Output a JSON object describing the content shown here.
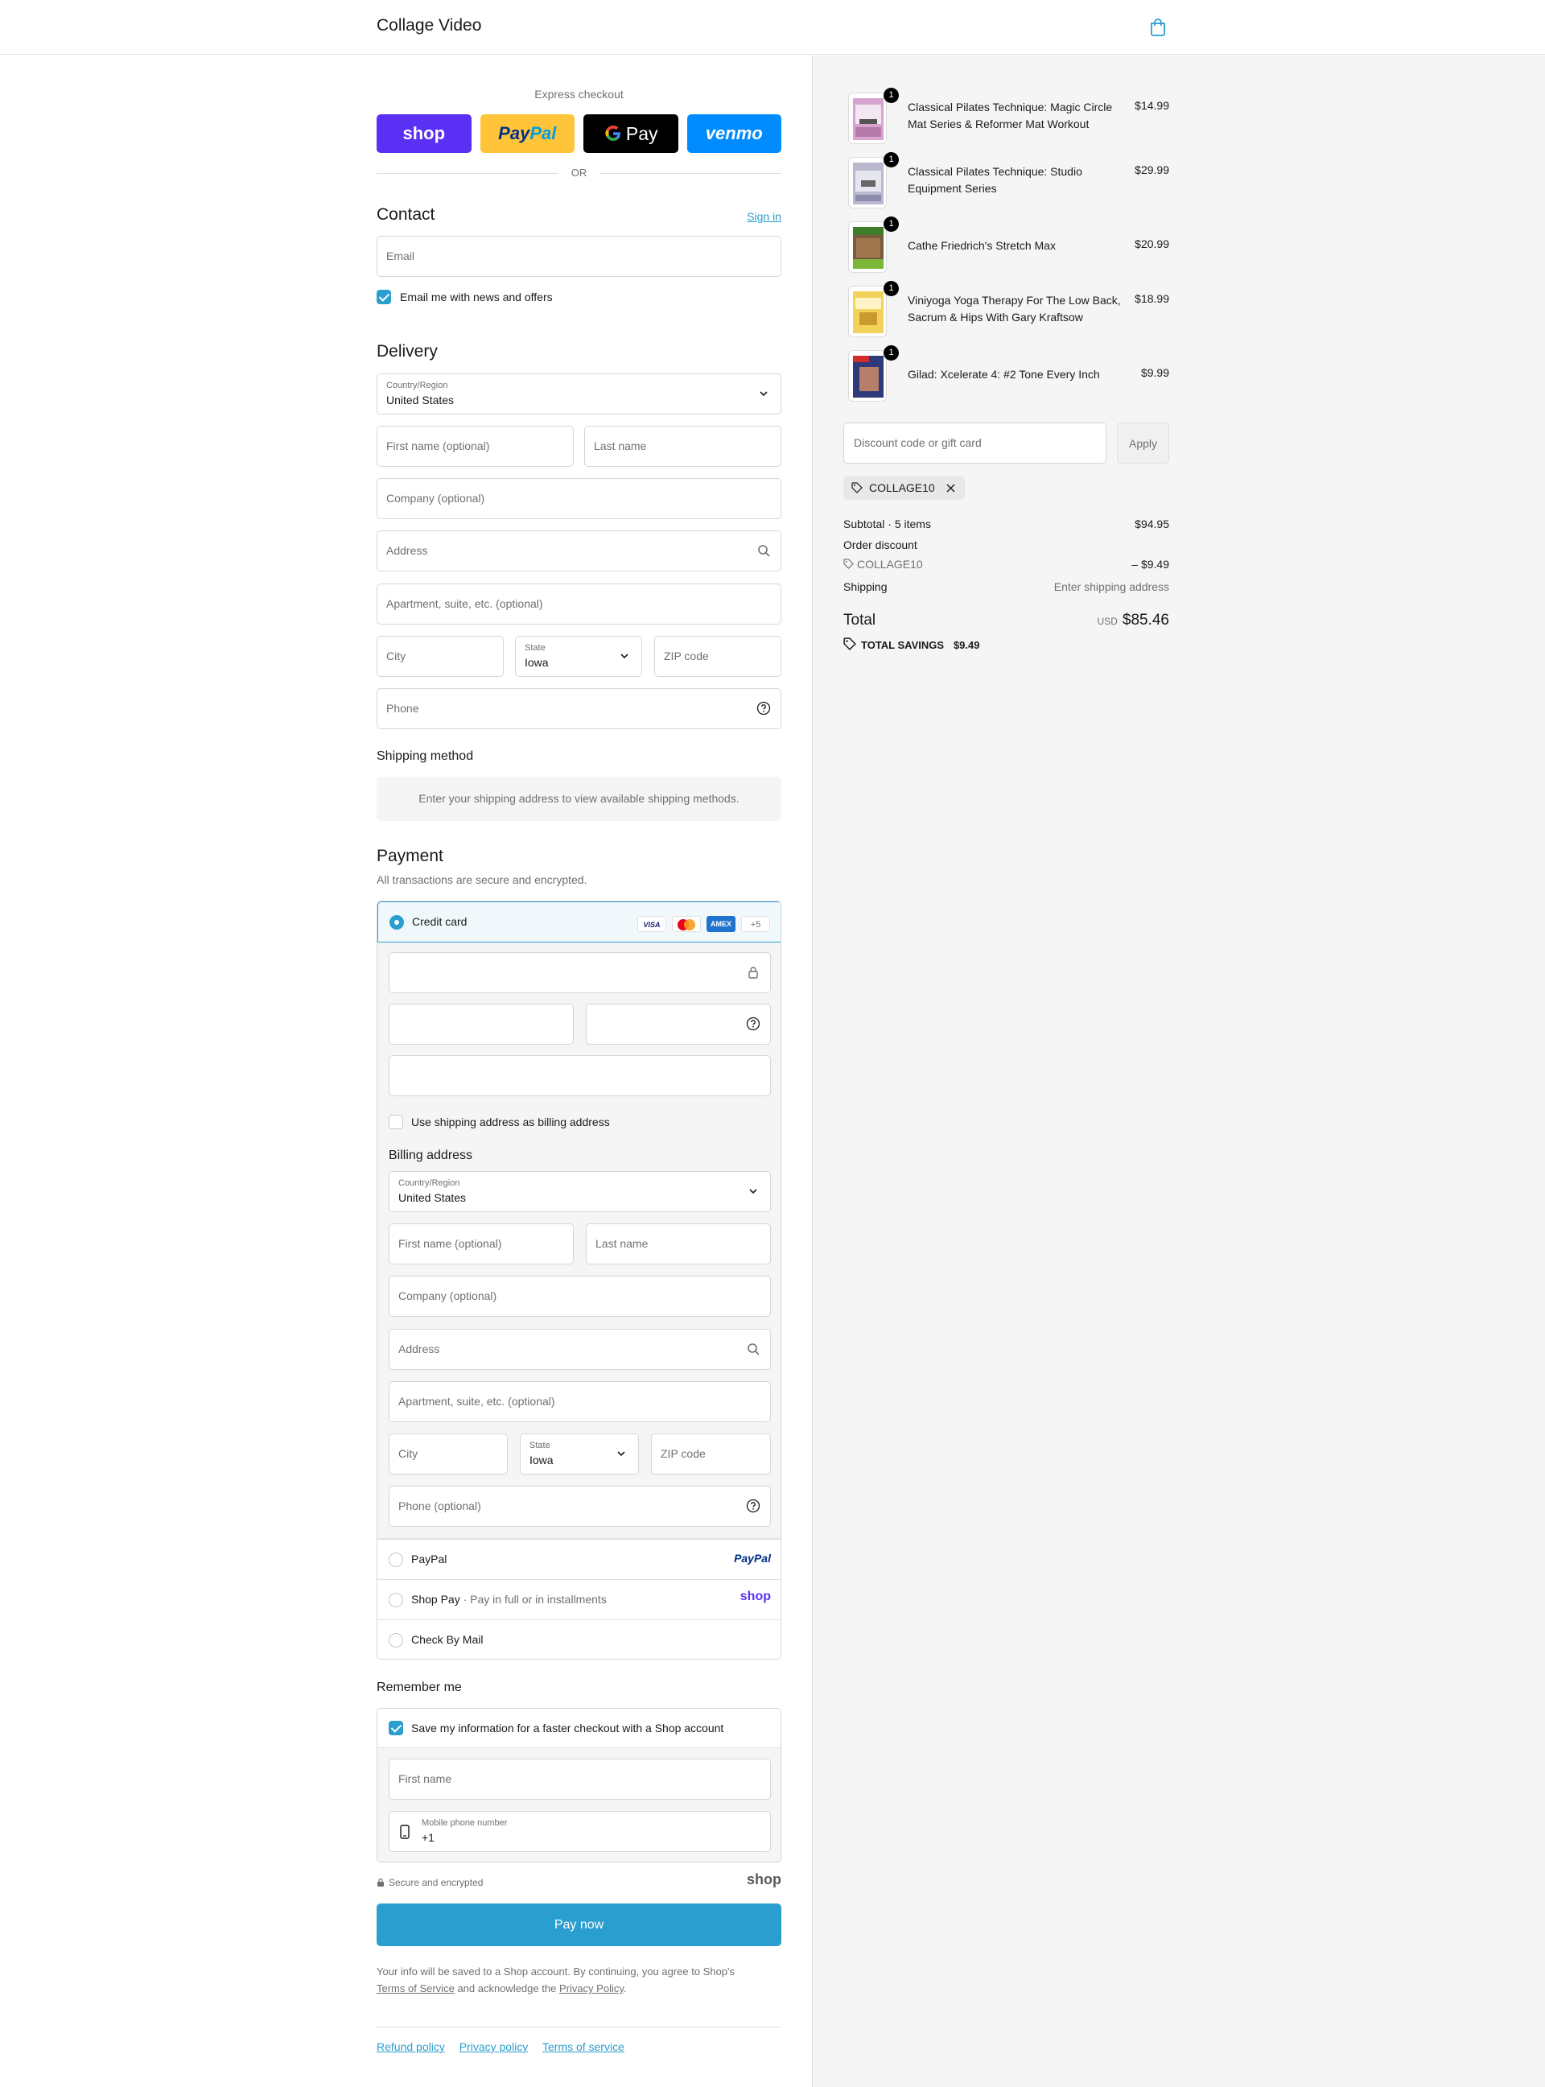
{
  "header": {
    "store_name": "Collage Video"
  },
  "express": {
    "label": "Express checkout",
    "shop": "shop",
    "paypal_a": "Pay",
    "paypal_b": "Pal",
    "gpay": "Pay",
    "venmo": "venmo",
    "or": "OR"
  },
  "contact": {
    "title": "Contact",
    "sign_in": "Sign in",
    "email_placeholder": "Email",
    "news_label": "Email me with news and offers"
  },
  "delivery": {
    "title": "Delivery",
    "country_label": "Country/Region",
    "country_value": "United States",
    "first_name": "First name (optional)",
    "last_name": "Last name",
    "company": "Company (optional)",
    "address": "Address",
    "apartment": "Apartment, suite, etc. (optional)",
    "city": "City",
    "state_label": "State",
    "state_value": "Iowa",
    "zip": "ZIP code",
    "phone": "Phone"
  },
  "shipping_method": {
    "title": "Shipping method",
    "notice": "Enter your shipping address to view available shipping methods."
  },
  "payment": {
    "title": "Payment",
    "subtitle": "All transactions are secure and encrypted.",
    "credit_card": "Credit card",
    "card_visa": "VISA",
    "card_amex": "AMEX",
    "card_more": "+5",
    "use_shipping": "Use shipping address as billing address",
    "billing_title": "Billing address",
    "billing": {
      "country_label": "Country/Region",
      "country_value": "United States",
      "first_name": "First name (optional)",
      "last_name": "Last name",
      "company": "Company (optional)",
      "address": "Address",
      "apartment": "Apartment, suite, etc. (optional)",
      "city": "City",
      "state_label": "State",
      "state_value": "Iowa",
      "zip": "ZIP code",
      "phone": "Phone (optional)"
    },
    "paypal": "PayPal",
    "paypal_logo": "PayPal",
    "shop_pay": "Shop Pay",
    "shop_pay_sub": "Pay in full or in installments",
    "shop_logo": "shop",
    "check_mail": "Check By Mail"
  },
  "remember": {
    "title": "Remember me",
    "save_label": "Save my information for a faster checkout with a Shop account",
    "first_name": "First name",
    "mobile_label": "Mobile phone number",
    "mobile_value": "+1"
  },
  "secure": {
    "text": "Secure and encrypted",
    "shop_logo": "shop"
  },
  "pay_now": "Pay now",
  "legal": {
    "pre": "Your info will be saved to a Shop account. By continuing, you agree to Shop's",
    "terms": "Terms of Service",
    "mid": "and acknowledge the",
    "privacy": "Privacy Policy",
    "end": "."
  },
  "footer": {
    "refund": "Refund policy",
    "privacy": "Privacy policy",
    "terms": "Terms of service"
  },
  "summary": {
    "items": [
      {
        "title": "Classical Pilates Technique: Magic Circle Mat Series & Reformer Mat Workout",
        "price": "$14.99",
        "qty": "1"
      },
      {
        "title": "Classical Pilates Technique: Studio Equipment Series",
        "price": "$29.99",
        "qty": "1"
      },
      {
        "title": "Cathe Friedrich's Stretch Max",
        "price": "$20.99",
        "qty": "1"
      },
      {
        "title": "Viniyoga Yoga Therapy For The Low Back, Sacrum & Hips With Gary Kraftsow",
        "price": "$18.99",
        "qty": "1"
      },
      {
        "title": "Gilad: Xcelerate 4: #2 Tone Every Inch",
        "price": "$9.99",
        "qty": "1"
      }
    ],
    "discount_placeholder": "Discount code or gift card",
    "apply": "Apply",
    "code": "COLLAGE10",
    "subtotal_label": "Subtotal · 5 items",
    "subtotal_value": "$94.95",
    "order_discount_label": "Order discount",
    "discount_code": "COLLAGE10",
    "discount_value": "– $9.49",
    "shipping_label": "Shipping",
    "shipping_value": "Enter shipping address",
    "total_label": "Total",
    "currency": "USD",
    "total_value": "$85.46",
    "savings_label": "TOTAL SAVINGS",
    "savings_value": "$9.49"
  }
}
